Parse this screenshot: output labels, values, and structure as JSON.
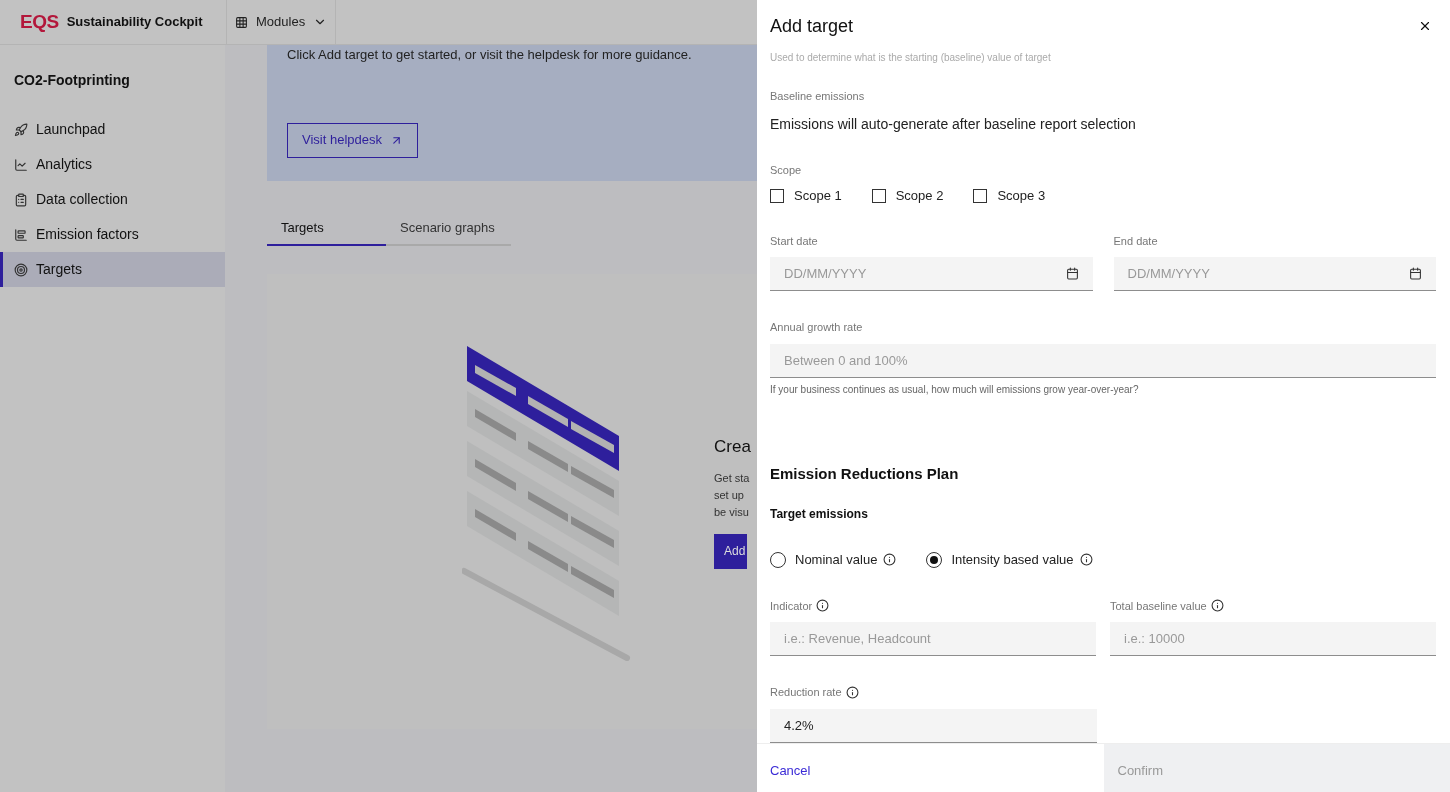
{
  "header": {
    "logo": "EQS",
    "brand": "Sustainability Cockpit",
    "modules": "Modules"
  },
  "sidebar": {
    "title": "CO2-Footprinting",
    "items": [
      {
        "label": "Launchpad",
        "selected": false
      },
      {
        "label": "Analytics",
        "selected": false
      },
      {
        "label": "Data collection",
        "selected": false
      },
      {
        "label": "Emission factors",
        "selected": false
      },
      {
        "label": "Targets",
        "selected": true
      }
    ]
  },
  "banner": {
    "text": "Click Add target to get started, or visit the helpdesk for more guidance.",
    "button": "Visit helpdesk"
  },
  "tabs": [
    {
      "label": "Targets",
      "selected": true
    },
    {
      "label": "Scenario graphs",
      "selected": false
    }
  ],
  "empty_state": {
    "title": "Crea",
    "lines": [
      "Get sta",
      "set up",
      "be visu"
    ],
    "button": "Add"
  },
  "dialog": {
    "title": "Add target",
    "cut_text": "Used to determine what is the starting (baseline) value of target",
    "baseline_label": "Baseline emissions",
    "baseline_text": "Emissions will auto-generate after baseline report selection",
    "scope_label": "Scope",
    "scopes": [
      {
        "label": "Scope 1",
        "checked": false
      },
      {
        "label": "Scope 2",
        "checked": false
      },
      {
        "label": "Scope 3",
        "checked": false
      }
    ],
    "start_date": {
      "label": "Start date",
      "placeholder": "DD/MM/YYYY"
    },
    "end_date": {
      "label": "End date",
      "placeholder": "DD/MM/YYYY"
    },
    "growth": {
      "label": "Annual growth rate",
      "placeholder": "Between 0 and 100%",
      "helper": "If your business continues as usual, how much will emissions grow year-over-year?"
    },
    "section_title": "Emission Reductions Plan",
    "subsection": "Target emissions",
    "options": [
      {
        "label": "Nominal value",
        "selected": false
      },
      {
        "label": "Intensity based value",
        "selected": true
      }
    ],
    "indicator": {
      "label": "Indicator",
      "placeholder": "i.e.: Revenue, Headcount"
    },
    "total_baseline": {
      "label": "Total baseline value",
      "placeholder": "i.e.: 10000"
    },
    "reduction": {
      "label": "Reduction rate",
      "value": "4.2%"
    },
    "cancel": "Cancel",
    "confirm": {
      "label": "Confirm",
      "disabled": true
    }
  }
}
